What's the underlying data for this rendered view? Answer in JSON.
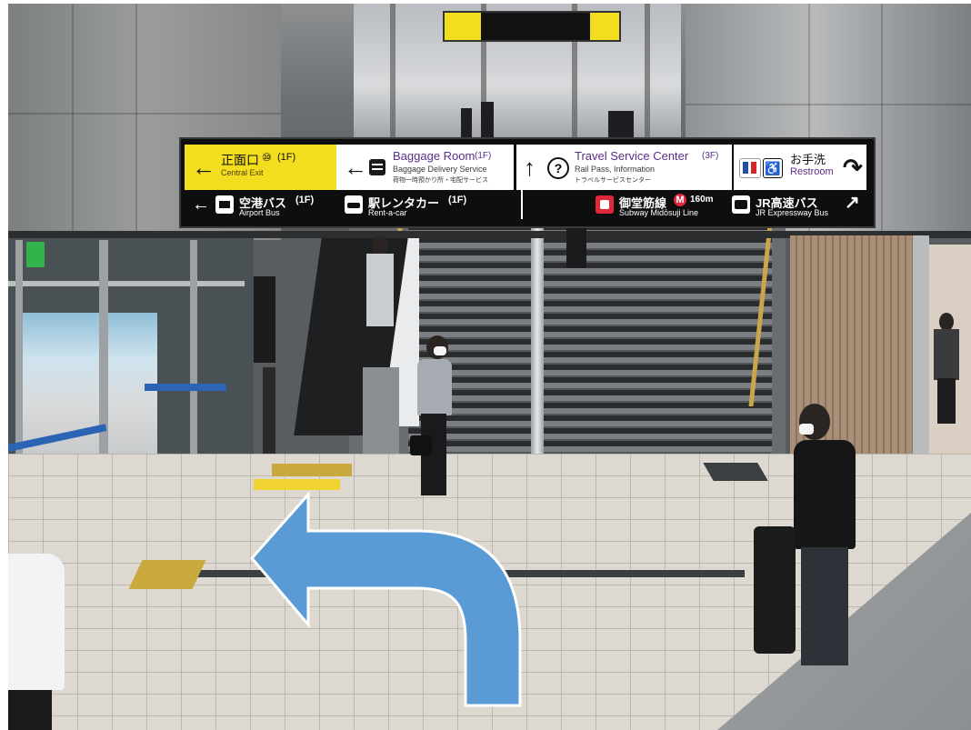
{
  "top_sign": {},
  "overhead_sign": {
    "central_exit": {
      "arrow": "←",
      "jp": "正面口",
      "badge": "⑩",
      "floor": "(1F)",
      "en": "Central Exit",
      "sub": ""
    },
    "baggage_room": {
      "arrow": "←",
      "title": "Baggage Room",
      "floor": "(1F)",
      "en": "Baggage Delivery Service",
      "sub": "荷物一時預かり所・宅配サービス"
    },
    "travel_service": {
      "arrow": "↑",
      "title": "Travel Service Center",
      "floor": "(3F)",
      "en": "Rail Pass, Information",
      "sub": "トラベルサービスセンター"
    },
    "restroom": {
      "arrow": "↷",
      "jp": "お手洗",
      "en": "Restroom"
    },
    "airport_bus": {
      "arrow": "←",
      "jp": "空港バス",
      "floor": "(1F)",
      "en": "Airport Bus"
    },
    "rent_a_car": {
      "jp": "駅レンタカー",
      "floor": "(1F)",
      "en": "Rent-a-car"
    },
    "subway": {
      "jp": "御堂筋線",
      "badge": "M",
      "distance": "160m",
      "en": "Subway Midōsuji Line"
    },
    "jr_bus": {
      "jp": "JR高速バス",
      "en": "JR Expressway Bus",
      "arrow": "↗"
    }
  },
  "colors": {
    "sign_yellow": "#f2dd1f",
    "sign_black": "#0e0e0e",
    "arrow_blue": "#5b9bd5",
    "english_purple": "#5b2d86"
  },
  "icons": [
    "left-arrow-icon",
    "baggage-icon",
    "question-icon",
    "restroom-icon",
    "wheelchair-icon",
    "bus-icon",
    "car-icon",
    "subway-icon",
    "turn-arrow-icon"
  ]
}
